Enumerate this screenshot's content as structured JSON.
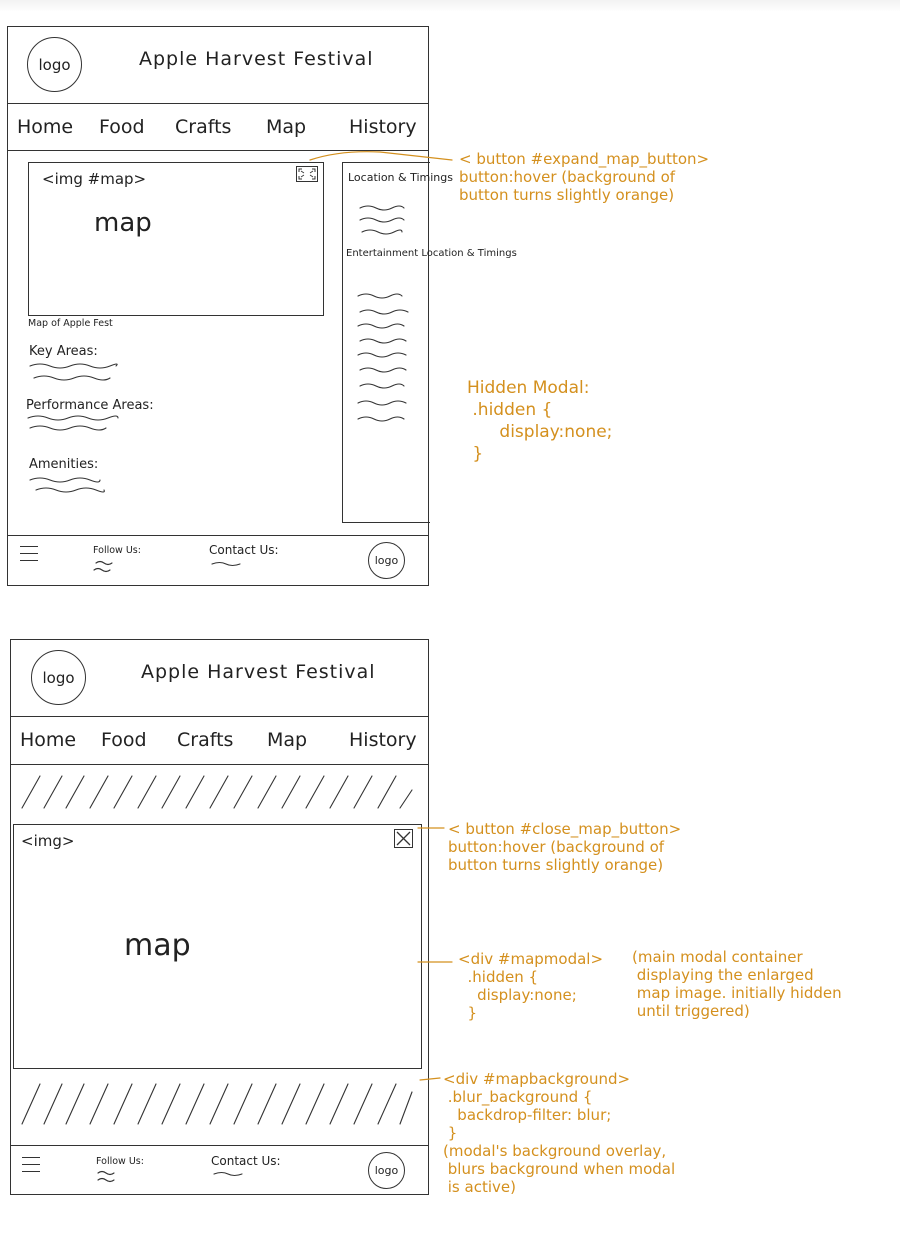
{
  "site": {
    "title": "Apple Harvest Festival",
    "logo_text": "logo",
    "nav": [
      "Home",
      "Food",
      "Crafts",
      "Map",
      "History"
    ]
  },
  "footer": {
    "follow_label": "Follow Us:",
    "contact_label": "Contact Us:",
    "logo_text": "logo"
  },
  "wireframe1": {
    "img_tag": "<img #map>",
    "map_text": "map",
    "map_caption": "Map of Apple Fest",
    "sections": [
      "Key Areas:",
      "Performance Areas:",
      "Amenities:"
    ],
    "sidebar": {
      "heading1": "Location & Timings",
      "heading2": "Entertainment Location & Timings"
    }
  },
  "wireframe2": {
    "img_tag": "<img>",
    "map_text": "map"
  },
  "annotations": {
    "expand_button": "< button #expand_map_button>\nbutton:hover (background of\nbutton turns slightly orange)",
    "hidden_modal": "Hidden Modal:\n .hidden {\n      display:none;\n }",
    "close_button": "< button #close_map_button>\nbutton:hover (background of\nbutton turns slightly orange)",
    "map_modal": "<div #mapmodal>\n  .hidden {\n    display:none;\n  }",
    "map_modal_note": "(main modal container\n displaying the enlarged\n map image. initially hidden\n until triggered)",
    "map_background": "<div #mapbackground>\n .blur_background {\n   backdrop-filter: blur;\n }\n(modal's background overlay,\n blurs background when modal\n is active)"
  },
  "colors": {
    "annotation": "#d4901e",
    "ink": "#222222"
  }
}
